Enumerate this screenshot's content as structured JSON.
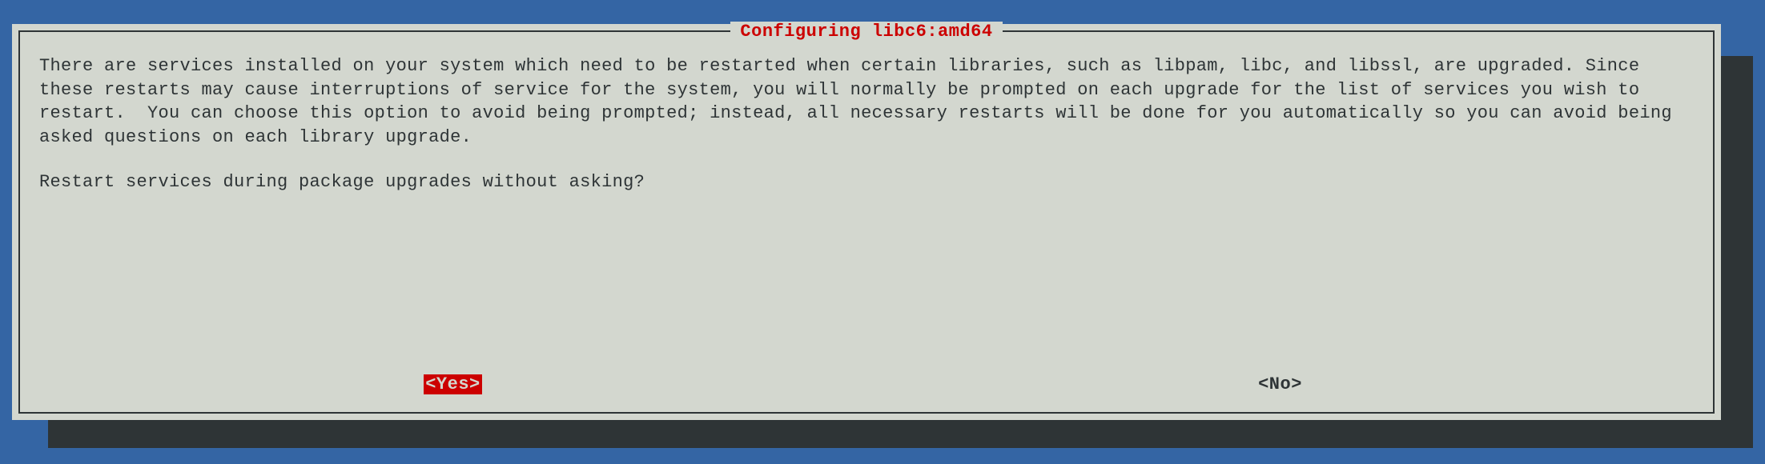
{
  "dialog": {
    "title": "Configuring libc6:amd64",
    "body": "There are services installed on your system which need to be restarted when certain libraries, such as libpam, libc, and libssl, are upgraded. Since these restarts may cause interruptions of service for the system, you will normally be prompted on each upgrade for the list of services you wish to restart.  You can choose this option to avoid being prompted; instead, all necessary restarts will be done for you automatically so you can avoid being asked questions on each library upgrade.",
    "question": "Restart services during package upgrades without asking?",
    "buttons": {
      "yes": "<Yes>",
      "no": "<No>"
    }
  }
}
